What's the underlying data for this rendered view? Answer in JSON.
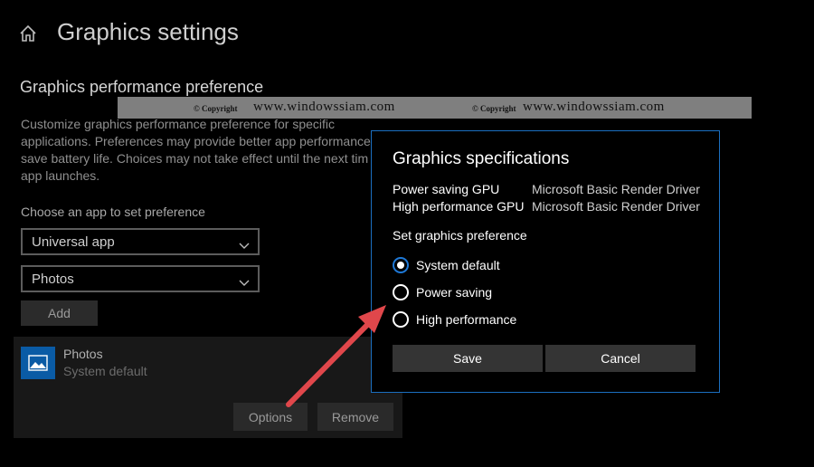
{
  "page": {
    "title": "Graphics settings"
  },
  "section": {
    "title": "Graphics performance preference",
    "description_lines": [
      "Customize graphics performance preference for specific",
      "applications. Preferences may provide better app performance",
      "save battery life. Choices may not take effect until the next tim",
      "app launches."
    ],
    "choose_label": "Choose an app to set preference",
    "app_type_select": "Universal app",
    "app_select": "Photos",
    "add_label": "Add"
  },
  "app_item": {
    "name": "Photos",
    "preference": "System default",
    "options_label": "Options",
    "remove_label": "Remove"
  },
  "watermark": {
    "copyright": "© Copyright",
    "site": "www.windowssiam.com"
  },
  "dialog": {
    "title": "Graphics specifications",
    "specs": [
      {
        "label": "Power saving GPU",
        "value": "Microsoft Basic Render Driver"
      },
      {
        "label": "High performance GPU",
        "value": "Microsoft Basic Render Driver"
      }
    ],
    "pref_label": "Set graphics preference",
    "options": [
      {
        "label": "System default",
        "selected": true
      },
      {
        "label": "Power saving",
        "selected": false
      },
      {
        "label": "High performance",
        "selected": false
      }
    ],
    "save_label": "Save",
    "cancel_label": "Cancel"
  },
  "colors": {
    "accent": "#1e78d6",
    "arrow": "#e0474b",
    "app_icon_bg": "#0a5ba5"
  },
  "icons": [
    "home-icon",
    "chevron-down-icon",
    "image-icon"
  ]
}
